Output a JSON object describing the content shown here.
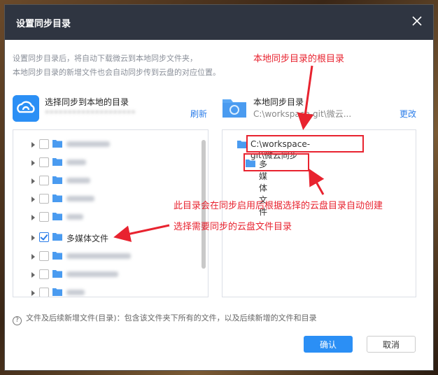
{
  "dialog": {
    "title": "设置同步目录",
    "description_line1": "设置同步目录后，将自动下载微云到本地同步文件夹，",
    "description_line2": "本地同步目录的新增文件也会自动同步传到云盘的对应位置。"
  },
  "source": {
    "title": "选择同步到本地的目录",
    "refresh": "刷新",
    "tree": [
      {
        "label": "",
        "checked": false
      },
      {
        "label": "",
        "checked": false
      },
      {
        "label": "",
        "checked": false
      },
      {
        "label": "",
        "checked": false
      },
      {
        "label": "",
        "checked": false
      },
      {
        "label": "多媒体文件",
        "checked": true
      },
      {
        "label": "",
        "checked": false
      },
      {
        "label": "",
        "checked": false
      },
      {
        "label": "",
        "checked": false
      }
    ]
  },
  "destination": {
    "title": "本地同步目录",
    "path_short": "C:\\workspace-git\\微云...",
    "change": "更改",
    "root_folder": "C:\\workspace-git\\微云同步",
    "child_folder": "多媒体文件"
  },
  "hint": {
    "icon": "question-icon",
    "text": "文件及后续新增文件(目录)：包含该文件夹下所有的文件，以及后续新增的文件和目录"
  },
  "buttons": {
    "ok": "确认",
    "cancel": "取消"
  },
  "annotations": {
    "root": "本地同步目录的根目录",
    "auto_create": "此目录会在同步启用后根据选择的云盘目录自动创建",
    "select": "选择需要同步的云盘文件目录"
  },
  "colors": {
    "accent": "#2b8ff5",
    "annotation": "#e8232f",
    "titlebar": "#2f3541"
  }
}
